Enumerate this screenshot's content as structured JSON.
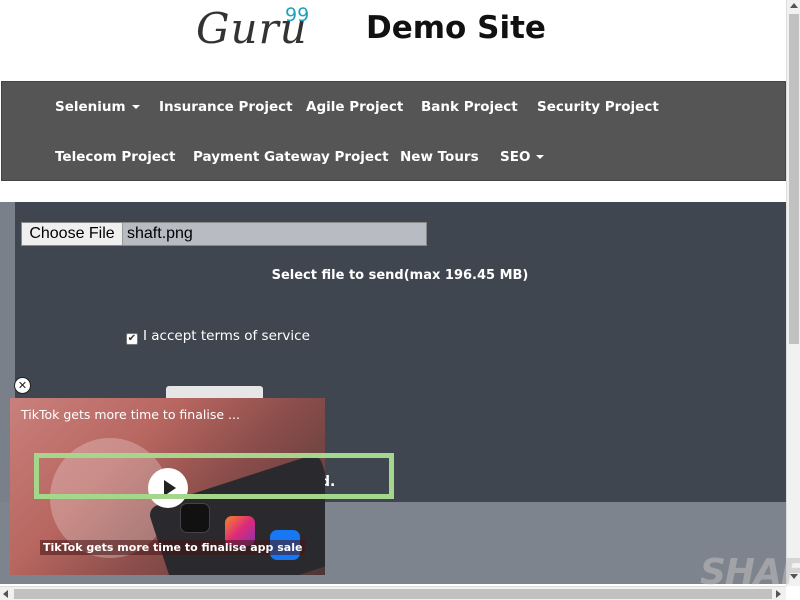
{
  "header": {
    "logo_text": "Guru",
    "logo_sup": "99",
    "site_title": "Demo Site"
  },
  "nav": {
    "row1": [
      {
        "label": "Selenium",
        "dropdown": true
      },
      {
        "label": "Insurance Project",
        "dropdown": false
      },
      {
        "label": "Agile Project",
        "dropdown": false
      },
      {
        "label": "Bank Project",
        "dropdown": false
      },
      {
        "label": "Security Project",
        "dropdown": false
      }
    ],
    "row2": [
      {
        "label": "Telecom Project",
        "dropdown": false
      },
      {
        "label": "Payment Gateway Project",
        "dropdown": false
      },
      {
        "label": "New Tours",
        "dropdown": false
      },
      {
        "label": "SEO",
        "dropdown": true
      }
    ]
  },
  "upload": {
    "choose_label": "Choose File",
    "file_name": "shaft.png",
    "select_text": "Select file to send(max 196.45 MB)",
    "terms_label": "I accept terms of service",
    "terms_checked": true,
    "partial_text": "d."
  },
  "video": {
    "title": "TikTok gets more time to finalise ...",
    "caption": "TikTok gets more time to finalise app sale",
    "close_icon": "close-icon",
    "play_icon": "play-icon"
  },
  "colors": {
    "navbar": "#555555",
    "panel": "#40464f",
    "accent": "#1fa3b8",
    "highlight": "#a4d68c"
  },
  "watermark": "SHAFT"
}
